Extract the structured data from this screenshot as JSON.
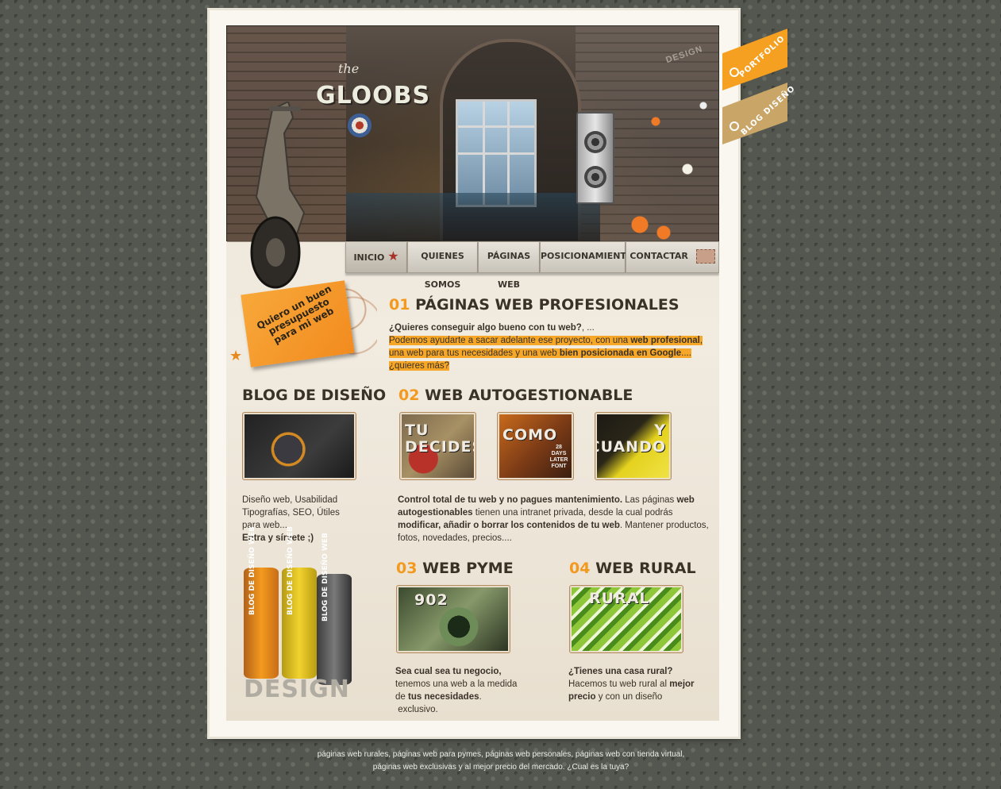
{
  "header": {
    "logo_prefix": "the",
    "logo": "GLOOBS",
    "design_tag": "DESIGN"
  },
  "nav": {
    "items": [
      {
        "label": "INICIO"
      },
      {
        "label": "QUIENES SOMOS"
      },
      {
        "label": "PÁGINAS WEB"
      },
      {
        "label": "POSICIONAMIENTO"
      },
      {
        "label": "CONTACTAR"
      }
    ]
  },
  "ribbons": {
    "portfolio": "PORTFOLIO",
    "blog": "BLOG DISEÑO",
    "colors": {
      "portfolio": "#f5a021",
      "blog": "#c9a568"
    }
  },
  "sticky": {
    "text": "Quiero un buen presupuesto para mi web"
  },
  "section1": {
    "num": "01",
    "title": "PÁGINAS WEB PROFESIONALES",
    "line1": "¿Quieres conseguir algo bueno con tu web?",
    "line1_tail": ", ...",
    "p_a": "Podemos ayudarte a sacar adelante ese proyecto, con una ",
    "p_b": "web profesional",
    "p_c": ", una web para tus necesidades y una web ",
    "p_d": "bien posicionada en Google",
    "p_e": ".... ¿quieres más?"
  },
  "blog": {
    "title": "BLOG DE DISEÑO",
    "lines": [
      "Diseño web, Usabilidad",
      "Tipografías, SEO, Útiles",
      "para web..."
    ],
    "cta": "Entra y sírvete ;)",
    "cans_label": "BLOG DE DISEÑO WEB",
    "design_watermark": "DESIGN"
  },
  "section2": {
    "num": "02",
    "title": "WEB AUTOGESTIONABLE",
    "thumbs": [
      "TU DECIDES",
      "COMO",
      "Y CUANDO"
    ],
    "thumb_sub": "28 DAYS LATER FONT",
    "t_a": "Control total de tu web y no pagues mantenimiento.",
    "t_b": " Las páginas ",
    "t_c": "web autogestionables",
    "t_d": " tienen una intranet privada, desde la cual podrás ",
    "t_e": "modificar, añadir o borrar los contenidos de tu web",
    "t_f": ". Mantener productos, fotos, novedades, precios...."
  },
  "section3": {
    "num": "03",
    "title": "WEB PYME",
    "thumb": "902",
    "t_a": "Sea cual sea tu negocio,",
    "t_b": "tenemos una web a la medida",
    "t_c": "de ",
    "t_d": "tus necesidades",
    "t_e": ".",
    "t_f": "exclusivo."
  },
  "section4": {
    "num": "04",
    "title": "WEB RURAL",
    "thumb": "RURAL",
    "t_a": "¿Tienes una casa rural?",
    "t_b": "Hacemos tu web rural al ",
    "t_c": "mejor precio",
    "t_d": " y con un diseño"
  },
  "footer": {
    "line1": "páginas web rurales, páginas web para pymes, páginas web personales, páginas web con tienda virtual,",
    "line2": "páginas web exclusivas y al mejor precio del mercado. ¿Cual es la tuya?"
  },
  "colors": {
    "accent": "#f39a1e",
    "highlight": "#f6a727",
    "background": "#54574f"
  }
}
